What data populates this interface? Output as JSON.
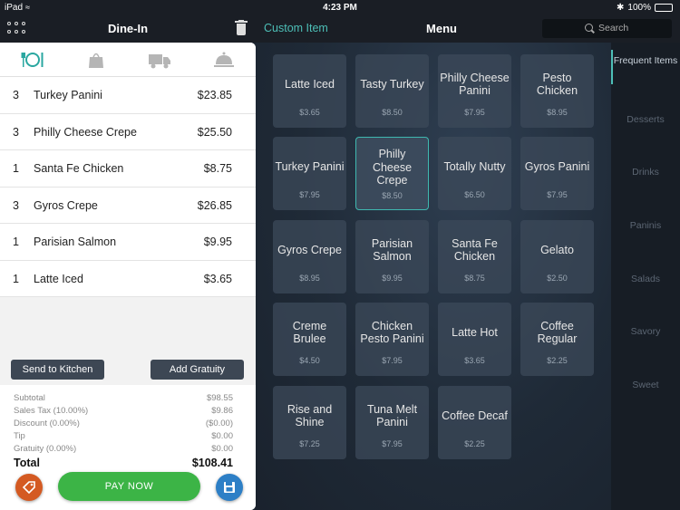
{
  "status_bar": {
    "carrier": "iPad",
    "time": "4:23 PM",
    "battery": "100%"
  },
  "order": {
    "title": "Dine-In",
    "items": [
      {
        "qty": "3",
        "name": "Turkey Panini",
        "price": "$23.85"
      },
      {
        "qty": "3",
        "name": "Philly Cheese Crepe",
        "price": "$25.50"
      },
      {
        "qty": "1",
        "name": "Santa Fe Chicken",
        "price": "$8.75"
      },
      {
        "qty": "3",
        "name": "Gyros Crepe",
        "price": "$26.85"
      },
      {
        "qty": "1",
        "name": "Parisian Salmon",
        "price": "$9.95"
      },
      {
        "qty": "1",
        "name": "Latte Iced",
        "price": "$3.65"
      }
    ],
    "send_to_kitchen": "Send to Kitchen",
    "add_gratuity": "Add Gratuity",
    "summary": [
      {
        "label": "Subtotal",
        "value": "$98.55"
      },
      {
        "label": "Sales Tax (10.00%)",
        "value": "$9.86"
      },
      {
        "label": "Discount (0.00%)",
        "value": "($0.00)"
      },
      {
        "label": "Tip",
        "value": "$0.00"
      },
      {
        "label": "Gratuity (0.00%)",
        "value": "$0.00"
      }
    ],
    "total_label": "Total",
    "total_value": "$108.41",
    "pay_now": "PAY  NOW"
  },
  "menu": {
    "custom_item": "Custom Item",
    "title": "Menu",
    "search_placeholder": "Search",
    "selected_item": "Philly Cheese Crepe",
    "items": [
      {
        "name": "Latte Iced",
        "price": "$3.65"
      },
      {
        "name": "Tasty Turkey",
        "price": "$8.50"
      },
      {
        "name": "Philly Cheese Panini",
        "price": "$7.95"
      },
      {
        "name": "Pesto Chicken",
        "price": "$8.95"
      },
      {
        "name": "Turkey Panini",
        "price": "$7.95"
      },
      {
        "name": "Philly Cheese Crepe",
        "price": "$8.50"
      },
      {
        "name": "Totally Nutty",
        "price": "$6.50"
      },
      {
        "name": "Gyros Panini",
        "price": "$7.95"
      },
      {
        "name": "Gyros Crepe",
        "price": "$8.95"
      },
      {
        "name": "Parisian Salmon",
        "price": "$9.95"
      },
      {
        "name": "Santa Fe Chicken",
        "price": "$8.75"
      },
      {
        "name": "Gelato",
        "price": "$2.50"
      },
      {
        "name": "Creme Brulee",
        "price": "$4.50"
      },
      {
        "name": "Chicken Pesto Panini",
        "price": "$7.95"
      },
      {
        "name": "Latte Hot",
        "price": "$3.65"
      },
      {
        "name": "Coffee Regular",
        "price": "$2.25"
      },
      {
        "name": "Rise and Shine",
        "price": "$7.25"
      },
      {
        "name": "Tuna Melt Panini",
        "price": "$7.95"
      },
      {
        "name": "Coffee Decaf",
        "price": "$2.25"
      }
    ]
  },
  "categories": {
    "active": "Frequent Items",
    "items": [
      "Frequent Items",
      "Desserts",
      "Drinks",
      "Paninis",
      "Salads",
      "Savory",
      "Sweet"
    ]
  },
  "colors": {
    "accent_teal": "#4dbfb7",
    "pay_green": "#3cb446",
    "coupon_orange": "#d45a22",
    "save_blue": "#2d7fc6",
    "tab_active_teal": "#2aa7a0"
  }
}
